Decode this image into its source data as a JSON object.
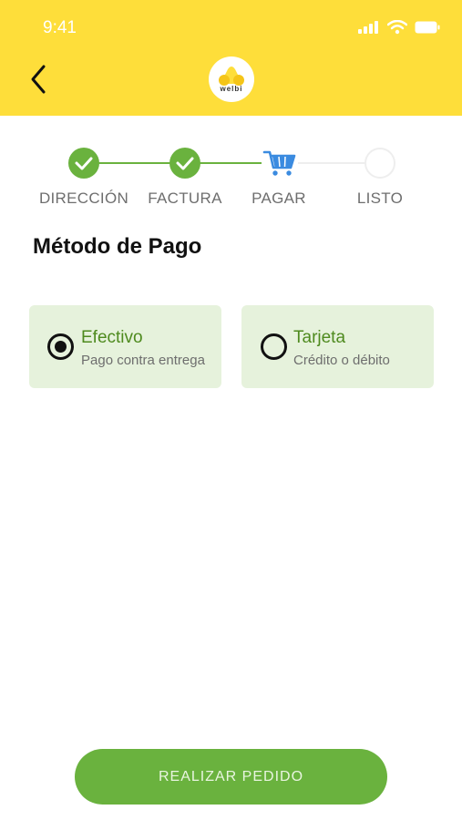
{
  "status_bar": {
    "time": "9:41"
  },
  "header": {
    "back_icon": "chevron-left-icon",
    "logo_text": "welbi",
    "logo_icon": "welbi-logo-icon"
  },
  "stepper": {
    "steps": [
      {
        "label": "DIRECCIÓN",
        "state": "done",
        "icon": "check-icon"
      },
      {
        "label": "FACTURA",
        "state": "done",
        "icon": "check-icon"
      },
      {
        "label": "PAGAR",
        "state": "current",
        "icon": "cart-icon"
      },
      {
        "label": "LISTO",
        "state": "pending",
        "icon": ""
      }
    ]
  },
  "page": {
    "title": "Método de Pago"
  },
  "payment_options": [
    {
      "title": "Efectivo",
      "subtitle": "Pago contra entrega",
      "selected": true
    },
    {
      "title": "Tarjeta",
      "subtitle": "Crédito o débito",
      "selected": false
    }
  ],
  "footer": {
    "submit_label": "REALIZAR PEDIDO"
  },
  "colors": {
    "header_bg": "#FEDE3A",
    "primary_green": "#6AB23E",
    "card_bg": "#E6F2DC",
    "cart_blue": "#3B8BE0"
  }
}
